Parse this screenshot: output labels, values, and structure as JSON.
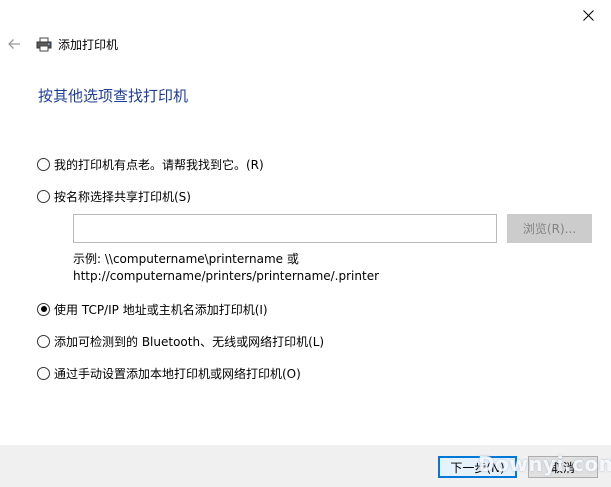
{
  "window": {
    "title": "添加打印机",
    "close_icon": "close-icon",
    "back_icon": "back-arrow-icon",
    "printer_icon": "printer-icon"
  },
  "heading": "按其他选项查找打印机",
  "options": [
    {
      "label": "我的打印机有点老。请帮我找到它。(R)",
      "checked": false
    },
    {
      "label": "按名称选择共享打印机(S)",
      "checked": false
    },
    {
      "label": "使用 TCP/IP 地址或主机名添加打印机(I)",
      "checked": true
    },
    {
      "label": "添加可检测到的 Bluetooth、无线或网络打印机(L)",
      "checked": false
    },
    {
      "label": "通过手动设置添加本地打印机或网络打印机(O)",
      "checked": false
    }
  ],
  "share_printer": {
    "value": "",
    "browse_label": "浏览(R)...",
    "example_line1": "示例: \\\\computername\\printername 或",
    "example_line2": "http://computername/printers/printername/.printer"
  },
  "footer": {
    "next_label": "下一步(N)",
    "cancel_label": "取消"
  },
  "watermark": "Downyi.com",
  "colors": {
    "heading": "#1f3f99",
    "accent": "#0078d7",
    "footer_bg": "#f0f0f0"
  }
}
